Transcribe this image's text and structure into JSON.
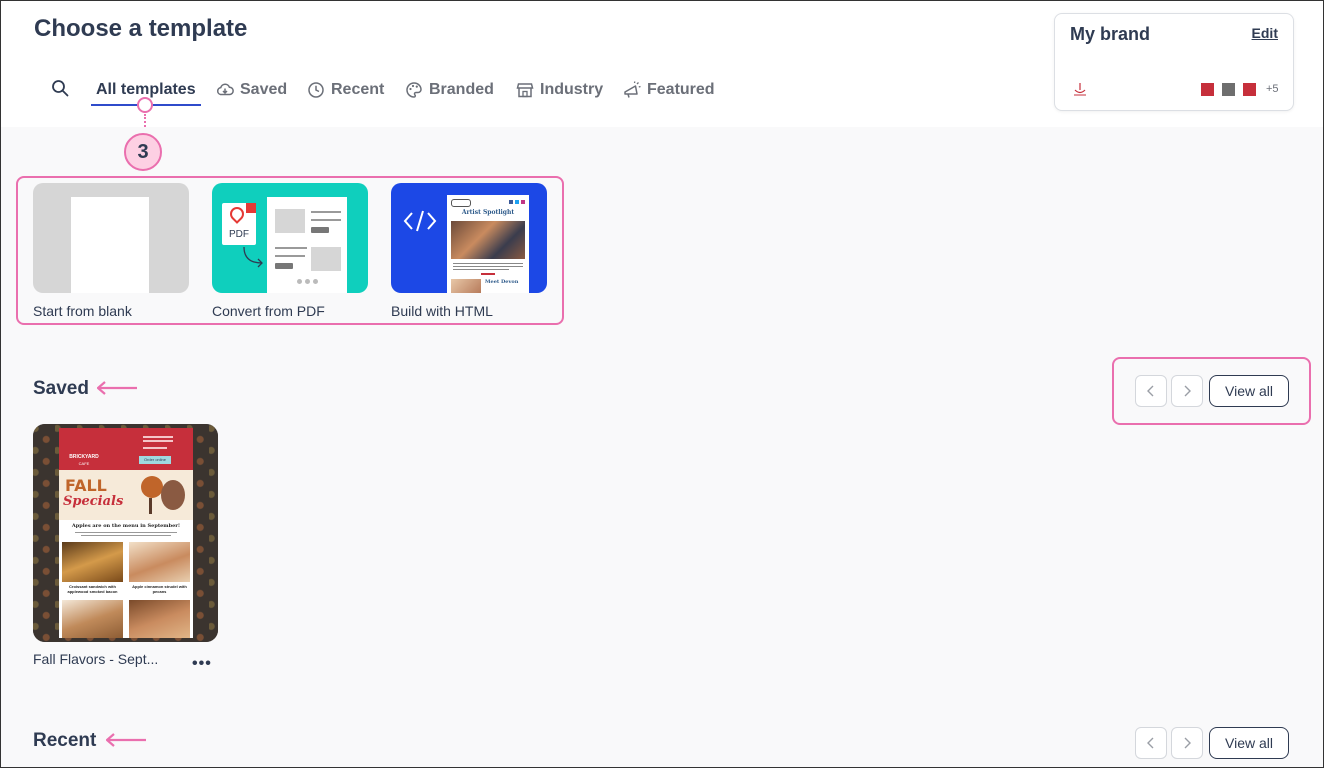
{
  "page_title": "Choose a template",
  "tabs": [
    {
      "label": "All templates",
      "icon": "none",
      "active": true
    },
    {
      "label": "Saved",
      "icon": "cloud-download-icon"
    },
    {
      "label": "Recent",
      "icon": "clock-icon"
    },
    {
      "label": "Branded",
      "icon": "palette-icon"
    },
    {
      "label": "Industry",
      "icon": "storefront-icon"
    },
    {
      "label": "Featured",
      "icon": "megaphone-icon"
    }
  ],
  "callout": {
    "number": "3"
  },
  "brand": {
    "title": "My brand",
    "edit_label": "Edit",
    "swatch_colors": [
      "#c62f3b",
      "#6e6e6e",
      "#c62f3b"
    ],
    "more_count": "+5"
  },
  "start_options": [
    {
      "label": "Start from blank"
    },
    {
      "label": "Convert from PDF",
      "badge": "PDF"
    },
    {
      "label": "Build with HTML",
      "thumb_title": "Artist Spotlight",
      "thumb_subtitle": "Meet Devon"
    }
  ],
  "sections": {
    "saved": {
      "title": "Saved",
      "view_all": "View all"
    },
    "recent": {
      "title": "Recent",
      "view_all": "View all"
    }
  },
  "saved_templates": [
    {
      "name": "Fall Flavors - Sept...",
      "thumb": {
        "brand": "BRICKYARD",
        "brand_sub": "CAFE",
        "button": "Order online",
        "headline1": "FALL",
        "headline2": "Specials",
        "subhead": "Apples are on the menu in September!",
        "item1": "Croissant sandwich with applewood smoked bacon",
        "item2": "Apple cinnamon strudel with pecans"
      }
    }
  ],
  "colors": {
    "accent": "#2f4bcb",
    "highlight": "#ea6fae",
    "pdf_bg": "#0fcfbd",
    "html_bg": "#1c48e6"
  }
}
